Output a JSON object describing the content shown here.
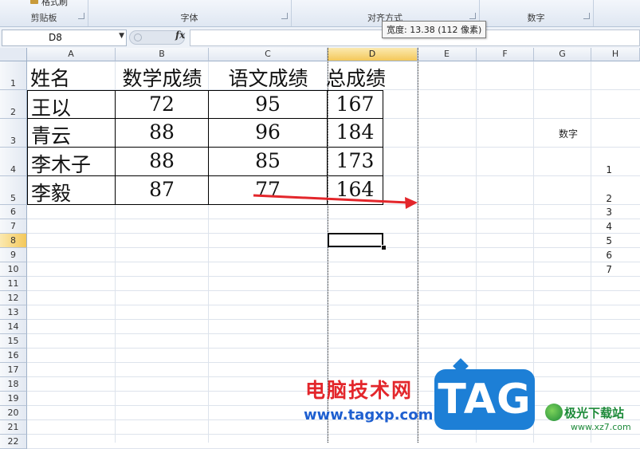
{
  "ribbon": {
    "partial_top_label": "格式刷",
    "groups": [
      {
        "label": "剪贴板"
      },
      {
        "label": "字体"
      },
      {
        "label": "对齐方式"
      },
      {
        "label": "数字"
      }
    ]
  },
  "formula_bar": {
    "name_box": "D8",
    "fx_label": "fx",
    "formula": ""
  },
  "tooltip": "宽度: 13.38 (112 像素)",
  "columns": [
    "A",
    "B",
    "C",
    "D",
    "E",
    "F",
    "G",
    "H"
  ],
  "selected_column": "D",
  "rows": [
    "1",
    "2",
    "3",
    "4",
    "5",
    "6",
    "7",
    "8",
    "9",
    "10",
    "11",
    "12",
    "13",
    "14",
    "15",
    "16",
    "17",
    "18",
    "19",
    "20",
    "21",
    "22"
  ],
  "selected_row": "8",
  "table": {
    "headers": [
      "姓名",
      "数学成绩",
      "语文成绩",
      "总成绩"
    ],
    "rows": [
      [
        "王以",
        "72",
        "95",
        "167"
      ],
      [
        "青云",
        "88",
        "96",
        "184"
      ],
      [
        "李木子",
        "88",
        "85",
        "173"
      ],
      [
        "李毅",
        "87",
        "77",
        "164"
      ]
    ]
  },
  "side_data": {
    "header": "数字",
    "values": [
      "1",
      "2",
      "3",
      "4",
      "5",
      "6",
      "7"
    ]
  },
  "watermark": {
    "site_cn": "电脑技术网",
    "url": "www.tagxp.com",
    "tag": "TAG",
    "site2": "极光下载站",
    "site2_url": "www.xz7.com"
  },
  "colors": {
    "arrow": "#e3262b",
    "selection_header": "#f4c85a"
  }
}
